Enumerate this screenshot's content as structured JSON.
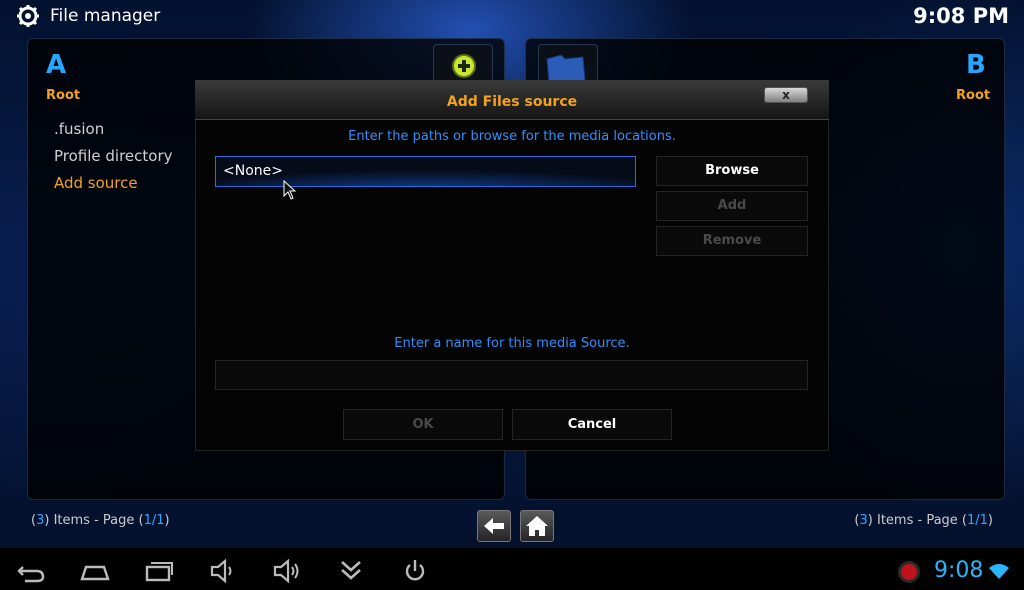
{
  "header": {
    "title": "File manager",
    "time": "9:08 PM"
  },
  "panel_a": {
    "letter": "A",
    "location": "Root",
    "items": [
      {
        "label": ".fusion"
      },
      {
        "label": "Profile directory"
      },
      {
        "label": "Add source"
      }
    ],
    "active_item": "Add source"
  },
  "panel_b": {
    "letter": "B",
    "location": "Root"
  },
  "dialog": {
    "title": "Add Files source",
    "close_label": "x",
    "paths_instructions": "Enter the paths or browse for the media locations.",
    "path_value": "<None>",
    "browse_label": "Browse",
    "add_label": "Add",
    "remove_label": "Remove",
    "name_instructions": "Enter a name for this media Source.",
    "name_value": "",
    "ok_label": "OK",
    "cancel_label": "Cancel"
  },
  "status": {
    "left": {
      "count": "3",
      "text": " Items - Page ",
      "page": "1/1"
    },
    "right": {
      "count": "3",
      "text": " Items - Page ",
      "page": "1/1"
    }
  },
  "system_bar": {
    "time": "9:08"
  },
  "colors": {
    "accent_blue": "#29a6ff",
    "accent_orange": "#f3a21c",
    "disabled_text": "#4a4a4a"
  },
  "icons": {
    "app": "gear-icon",
    "panel_a_tile": "add-circle-icon",
    "panel_b_tile": "folder-icon",
    "nav_back": "back-arrow-icon",
    "nav_home": "home-icon",
    "system": [
      "android-back-icon",
      "android-home-icon",
      "recent-apps-icon",
      "volume-down-icon",
      "volume-up-icon",
      "collapse-icon",
      "power-icon",
      "record-icon",
      "wifi-icon"
    ]
  }
}
